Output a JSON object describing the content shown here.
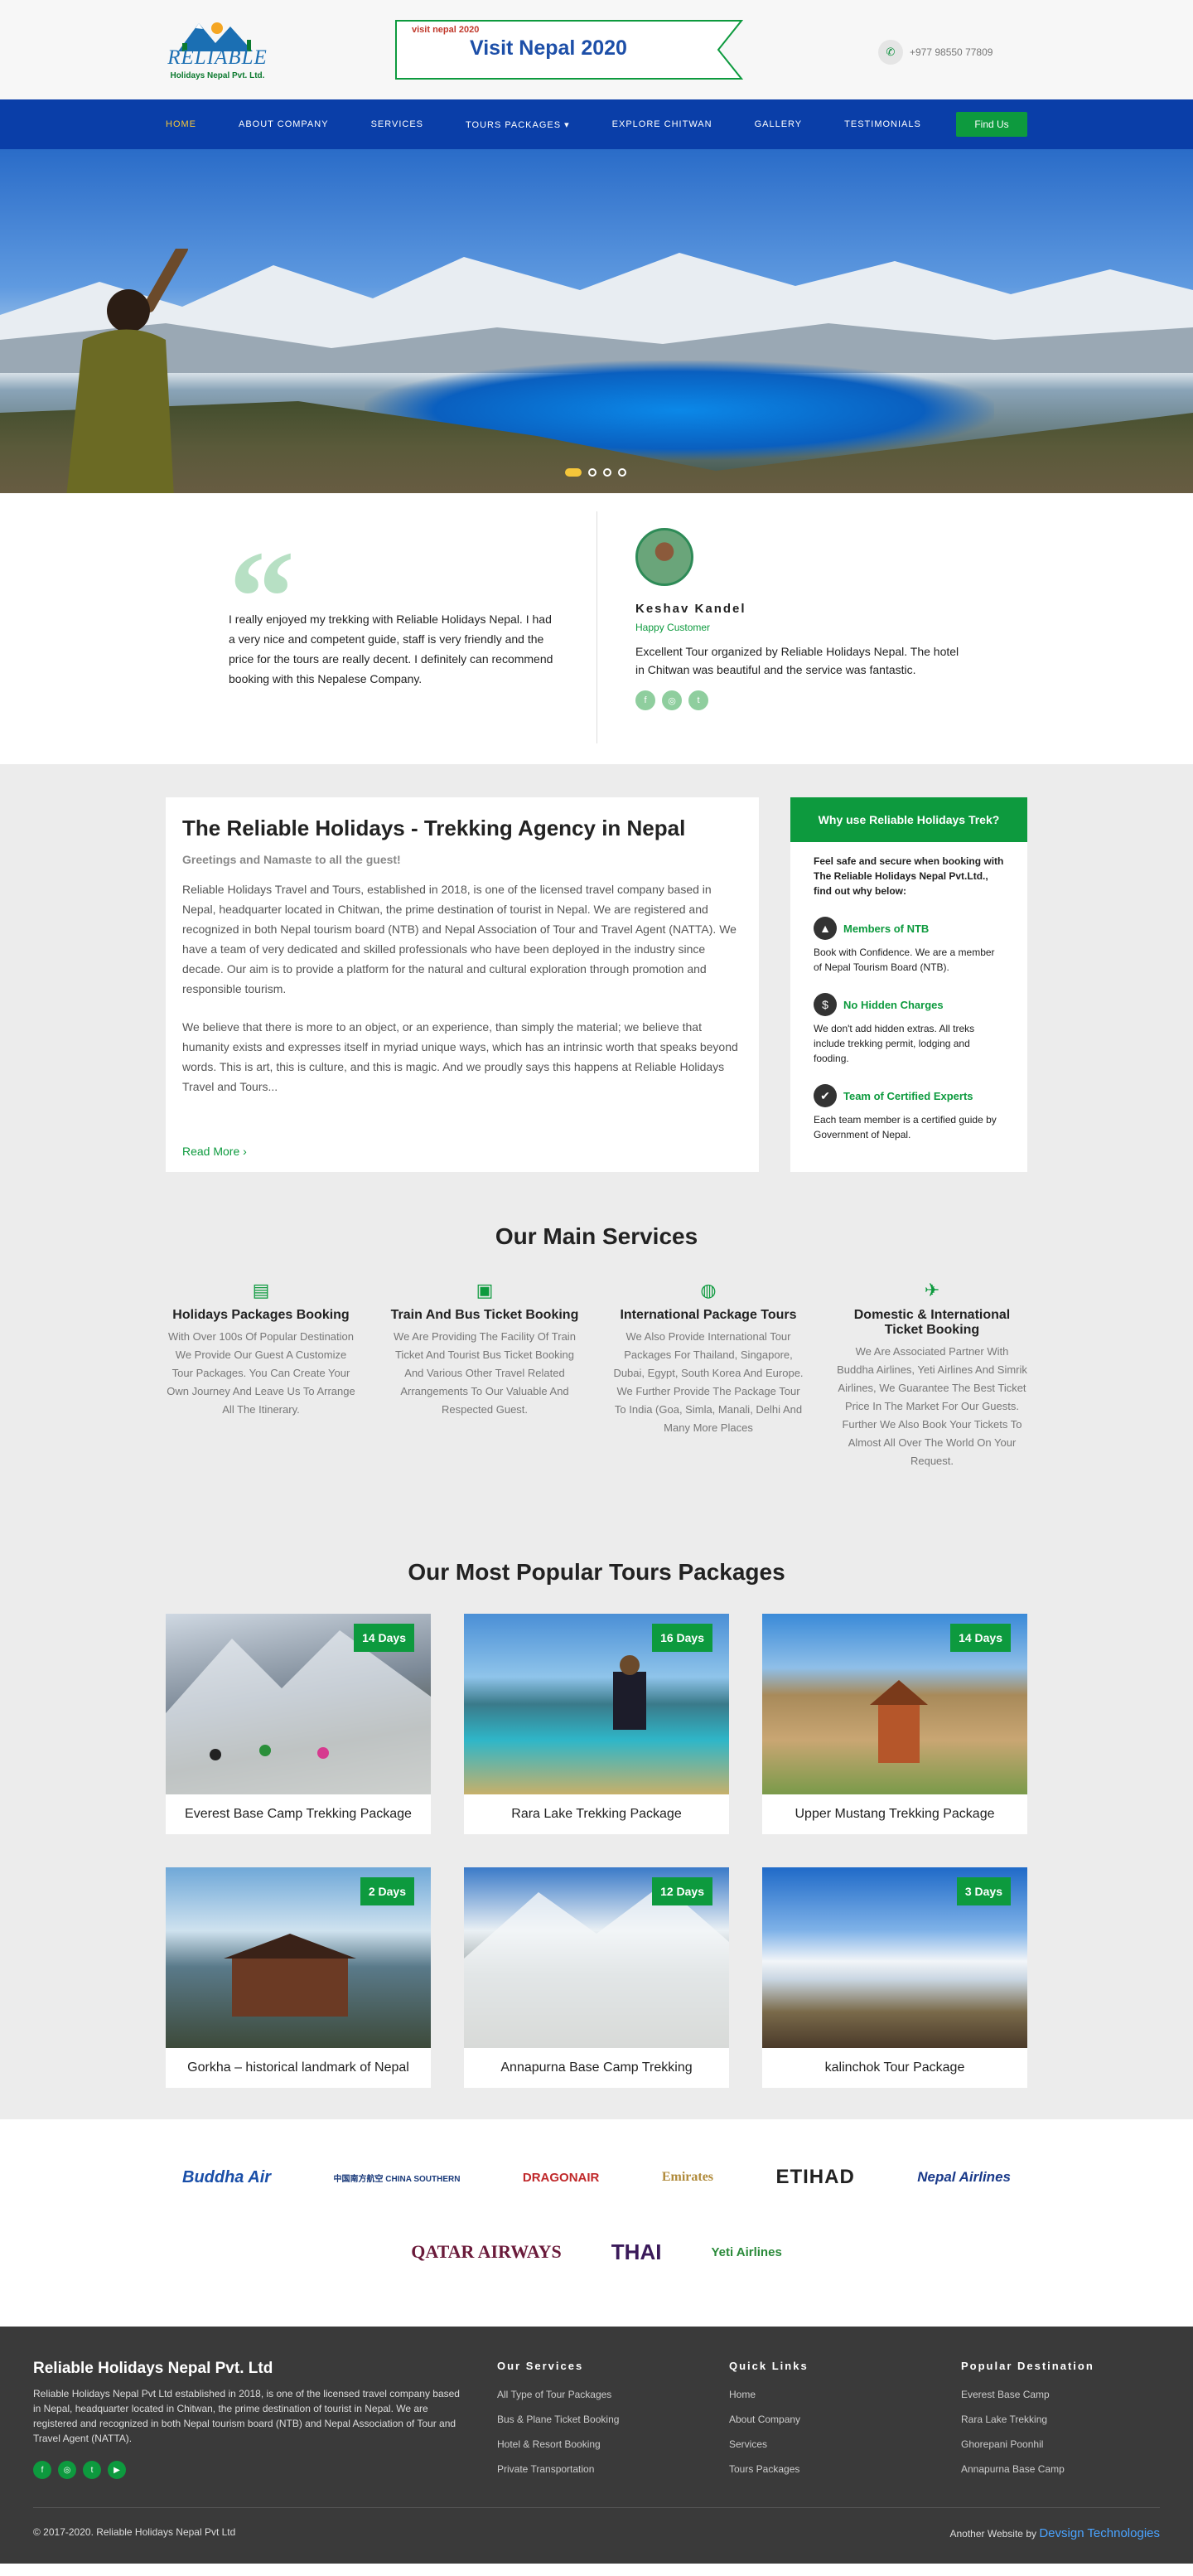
{
  "header": {
    "logo_text": "RELIABLE",
    "logo_sub": "Holidays Nepal Pvt. Ltd.",
    "visit_logo": "visit nepal 2020",
    "visit_text": "Visit Nepal 2020",
    "phone": "+977 98550 77809"
  },
  "nav": {
    "items": [
      "HOME",
      "ABOUT COMPANY",
      "SERVICES",
      "TOURS PACKAGES ▾",
      "EXPLORE CHITWAN",
      "GALLERY",
      "TESTIMONIALS"
    ],
    "find_us": "Find Us"
  },
  "testimonial": {
    "quote": "I really enjoyed my trekking with Reliable Holidays Nepal. I had a very nice and competent guide, staff is very friendly and the price for the tours are really decent. I definitely can recommend booking with this Nepalese Company.",
    "name": "Keshav Kandel",
    "role": "Happy Customer",
    "text": "Excellent Tour organized by Reliable Holidays Nepal. The hotel in Chitwan was beautiful and the service was fantastic."
  },
  "about": {
    "title": "The Reliable Holidays - Trekking Agency in Nepal",
    "subtitle": "Greetings and Namaste to all the guest!",
    "p1": "Reliable Holidays Travel and Tours, established in 2018, is one of the licensed travel company based in Nepal, headquarter located in Chitwan, the prime destination of tourist in Nepal. We are registered and recognized in both Nepal tourism board (NTB) and Nepal Association of Tour and Travel Agent (NATTA). We have a team of very dedicated and skilled professionals who have been deployed in the industry since decade. Our aim is to provide a platform for the natural and cultural exploration through promotion and responsible tourism.",
    "p2": "We believe that there is more to an object, or an experience, than simply the material; we believe that humanity exists and expresses itself in myriad unique ways, which has an intrinsic worth that speaks beyond words. This is art, this is culture, and this is magic. And we proudly says this happens at Reliable Holidays Travel and Tours...",
    "read_more": "Read More ›"
  },
  "why": {
    "title": "Why use Reliable Holidays Trek?",
    "intro": "Feel safe and secure when booking with The Reliable Holidays Nepal Pvt.Ltd., find out why below:",
    "items": [
      {
        "title": "Members of NTB",
        "desc": "Book with Confidence. We are a member of Nepal Tourism Board (NTB)."
      },
      {
        "title": "No Hidden Charges",
        "desc": "We don't add hidden extras. All treks include trekking permit, lodging and fooding."
      },
      {
        "title": "Team of Certified Experts",
        "desc": "Each team member is a certified guide by Government of Nepal."
      }
    ]
  },
  "services": {
    "title": "Our Main Services",
    "items": [
      {
        "title": "Holidays Packages Booking",
        "desc": "With Over 100s Of Popular Destination We Provide Our Guest A Customize Tour Packages. You Can Create Your Own Journey And Leave Us To Arrange All The Itinerary."
      },
      {
        "title": "Train And Bus Ticket Booking",
        "desc": "We Are Providing The Facility Of Train Ticket And Tourist Bus Ticket Booking And Various Other Travel Related Arrangements To Our Valuable And Respected Guest."
      },
      {
        "title": "International Package Tours",
        "desc": "We Also Provide International Tour Packages For Thailand, Singapore, Dubai, Egypt, South Korea And Europe. We Further Provide The Package Tour To India (Goa, Simla, Manali, Delhi And Many More Places"
      },
      {
        "title": "Domestic & International Ticket Booking",
        "desc": "We Are Associated Partner With Buddha Airlines, Yeti Airlines And Simrik Airlines, We Guarantee The Best Ticket Price In The Market For Our Guests. Further We Also Book Your Tickets To Almost All Over The World On Your Request."
      }
    ]
  },
  "tours": {
    "title": "Our Most Popular Tours Packages",
    "items": [
      {
        "name": "Everest Base Camp Trekking Package",
        "days": "14 Days"
      },
      {
        "name": "Rara Lake Trekking Package",
        "days": "16 Days"
      },
      {
        "name": "Upper Mustang Trekking Package",
        "days": "14 Days"
      },
      {
        "name": "Gorkha – historical landmark of Nepal",
        "days": "2 Days"
      },
      {
        "name": "Annapurna Base Camp Trekking",
        "days": "12 Days"
      },
      {
        "name": "kalinchok Tour Package",
        "days": "3 Days"
      }
    ]
  },
  "airlines": {
    "row1": [
      "Buddha Air",
      "中国南方航空 CHINA SOUTHERN",
      "DRAGONAIR",
      "Emirates",
      "ETIHAD",
      "Nepal Airlines"
    ],
    "row2": [
      "QATAR AIRWAYS",
      "THAI",
      "Yeti Airlines"
    ]
  },
  "footer": {
    "brand": "Reliable Holidays Nepal Pvt. Ltd",
    "desc": "Reliable Holidays Nepal Pvt Ltd established in 2018, is one of the licensed travel company based in Nepal, headquarter located in Chitwan, the prime destination of tourist in Nepal. We are registered and recognized in both Nepal tourism board (NTB) and Nepal Association of Tour and Travel Agent (NATTA).",
    "services_title": "Our Services",
    "services": [
      "All Type of Tour Packages",
      "Bus & Plane Ticket Booking",
      "Hotel & Resort Booking",
      "Private Transportation"
    ],
    "links_title": "Quick Links",
    "links": [
      "Home",
      "About Company",
      "Services",
      "Tours Packages"
    ],
    "dest_title": "Popular Destination",
    "dest": [
      "Everest Base Camp",
      "Rara Lake Trekking",
      "Ghorepani Poonhil",
      "Annapurna Base Camp"
    ],
    "copyright": "© 2017-2020. Reliable Holidays Nepal Pvt Ltd",
    "another_site": "Another Website by",
    "developer": "Devsign Technologies"
  },
  "colors": {
    "primary": "#0a3ea8",
    "accent": "#0d9a3e",
    "highlight": "#f5c63a"
  }
}
